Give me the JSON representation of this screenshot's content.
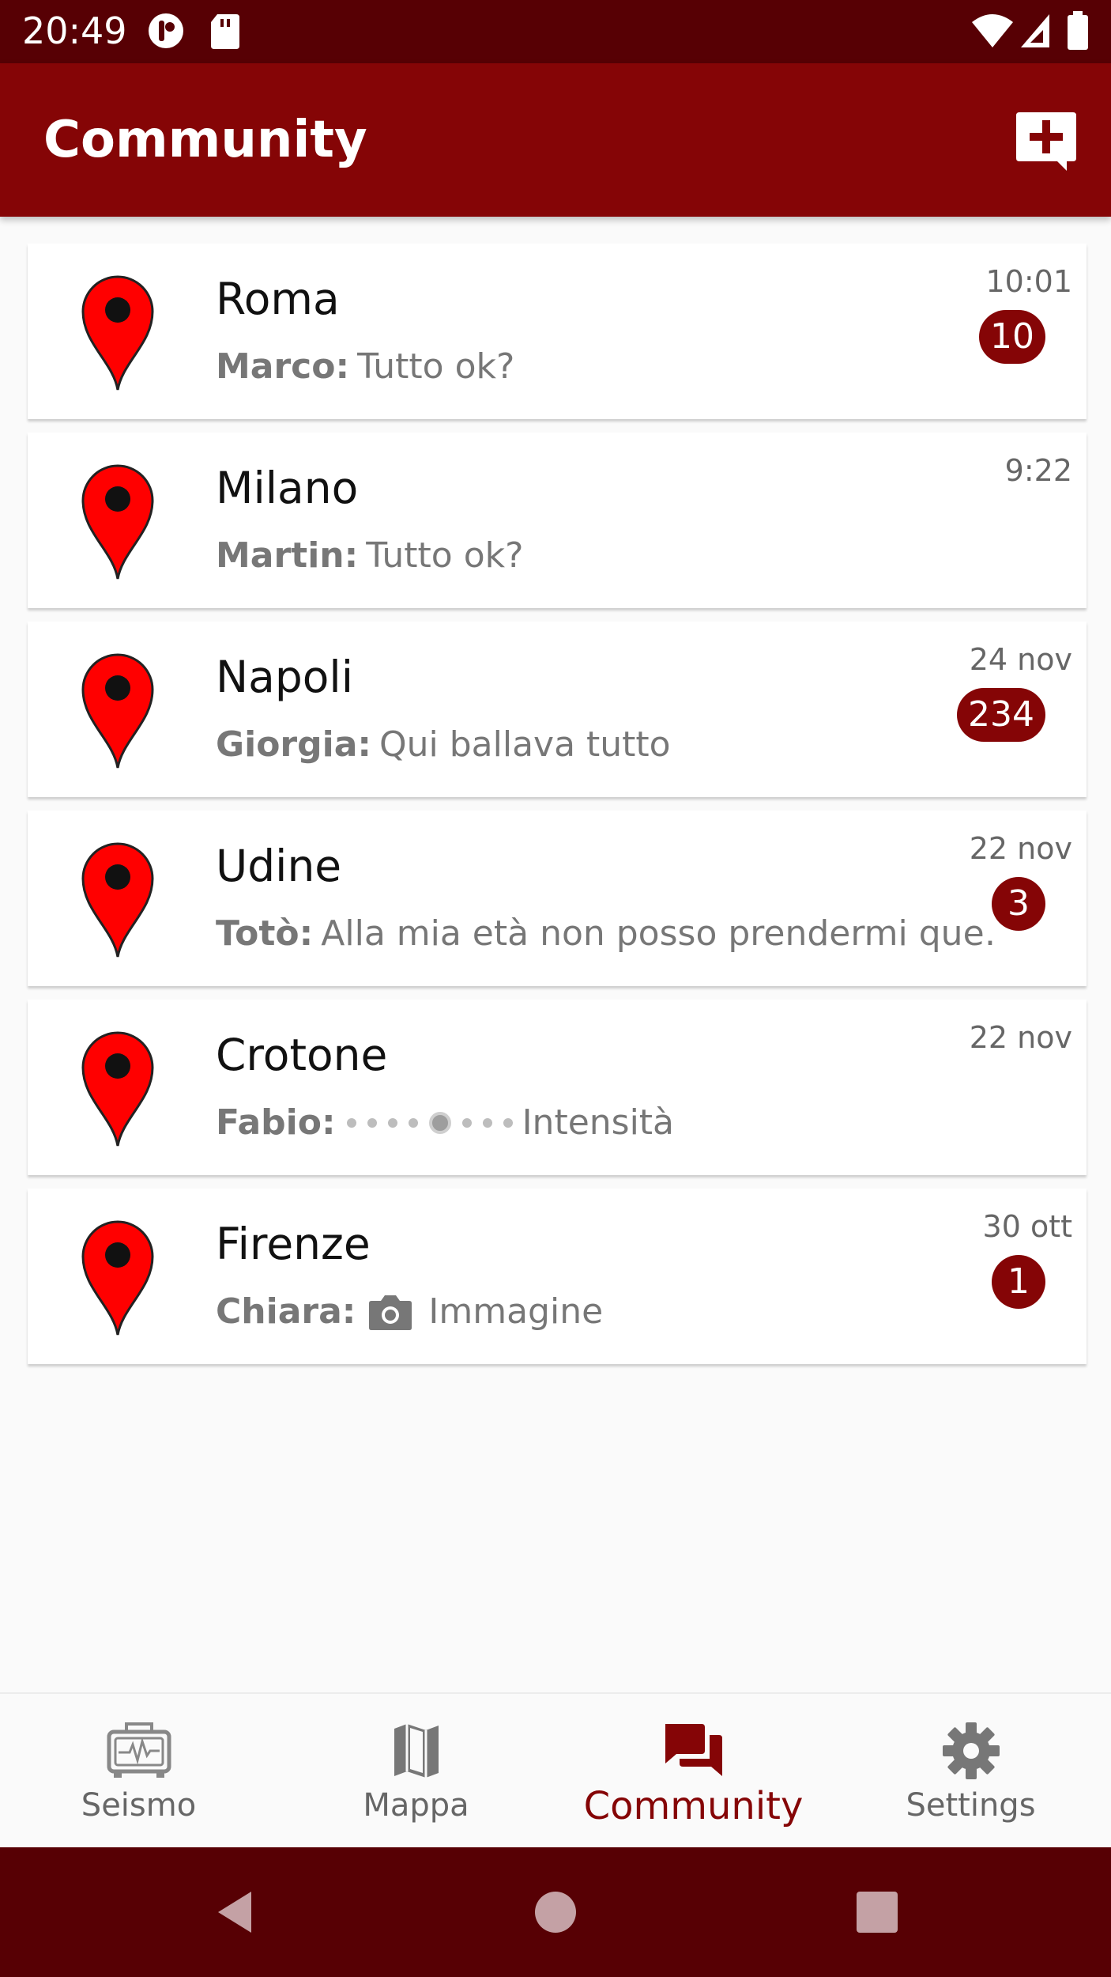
{
  "status_bar": {
    "time": "20:49"
  },
  "app_bar": {
    "title": "Community"
  },
  "chats": [
    {
      "city": "Roma",
      "sender": "Marco:",
      "message": "Tutto ok?",
      "time": "10:01",
      "unread": "10",
      "type": "text"
    },
    {
      "city": "Milano",
      "sender": "Martin:",
      "message": "Tutto ok?",
      "time": "9:22",
      "unread": "",
      "type": "text"
    },
    {
      "city": "Napoli",
      "sender": "Giorgia:",
      "message": "Qui ballava tutto",
      "time": "24 nov",
      "unread": "234",
      "type": "text"
    },
    {
      "city": "Udine",
      "sender": "Totò:",
      "message": "Alla mia età non posso prendermi que…",
      "time": "22 nov",
      "unread": "3",
      "type": "text"
    },
    {
      "city": "Crotone",
      "sender": "Fabio:",
      "message": "Intensità",
      "time": "22 nov",
      "unread": "",
      "type": "intensity"
    },
    {
      "city": "Firenze",
      "sender": "Chiara:",
      "message": "Immagine",
      "time": "30 ott",
      "unread": "1",
      "type": "image"
    }
  ],
  "bottom_nav": {
    "items": [
      {
        "label": "Seismo",
        "icon": "seismograph-icon"
      },
      {
        "label": "Mappa",
        "icon": "map-icon"
      },
      {
        "label": "Community",
        "icon": "forum-icon"
      },
      {
        "label": "Settings",
        "icon": "gear-icon"
      }
    ],
    "active": "Community"
  },
  "colors": {
    "primary": "#850506",
    "primary_dark": "#570004",
    "pin": "#ff0000"
  }
}
